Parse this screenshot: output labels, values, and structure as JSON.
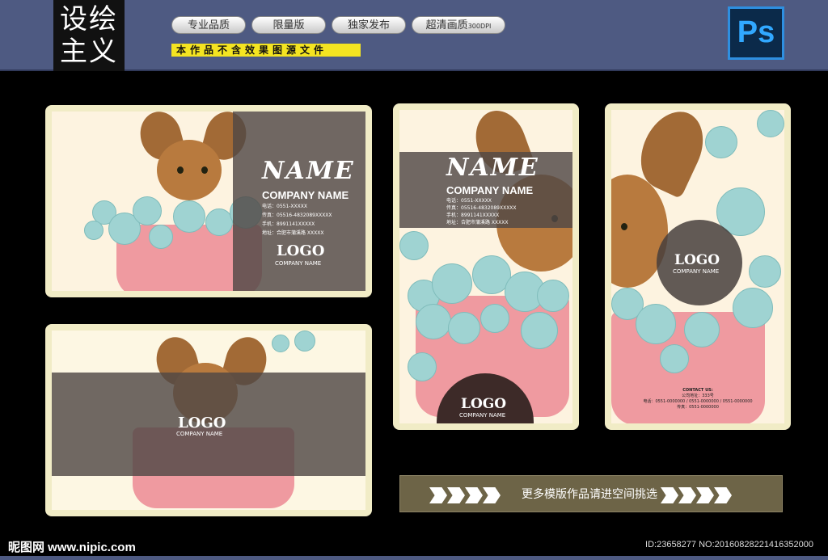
{
  "header": {
    "logo_text": "设绘\n主义",
    "pills": [
      {
        "label": "专业品质"
      },
      {
        "label": "限量版"
      },
      {
        "label": "独家发布"
      },
      {
        "label": "超清画质",
        "small": "300DPI"
      }
    ],
    "notice": "本作品不含效果图源文件",
    "app_icon": {
      "name": "photoshop-icon",
      "label": "Ps",
      "color": "#31a8ff"
    }
  },
  "cards": {
    "front": {
      "name": "NAME",
      "company": "COMPANY NAME",
      "phone": "电话：0551-XXXXX",
      "fax": "传真：05516-4832089XXXXX",
      "mobile": "手机：8991141XXXXX",
      "address": "地址：合肥市蒲溪路 XXXXX",
      "logo": "LOGO",
      "logo_company": "COMPANY NAME"
    },
    "back": {
      "logo": "LOGO",
      "logo_company": "COMPANY NAME"
    },
    "vertical_front": {
      "name": "NAME",
      "company": "COMPANY NAME",
      "phone": "电话：0551-XXXXX",
      "fax": "传真：05516-4832089XXXXX",
      "mobile": "手机：8991141XXXXX",
      "address": "地址：合肥市蒲溪路 XXXXX",
      "logo": "LOGO",
      "logo_company": "COMPANY NAME"
    },
    "vertical_back": {
      "logo": "LOGO",
      "logo_company": "COMPANY NAME",
      "contact_title": "CONTACT US:",
      "contact_address": "公司地址：333号",
      "contact_phones": "电话：0551-0000000 / 0551-0000000 / 0551-0000000",
      "contact_fax": "传真：0551-0000000"
    }
  },
  "banner": {
    "text": "更多模版作品请进空间挑选"
  },
  "watermark": {
    "left": "昵图网 www.nipic.com",
    "right": "ID:23658277 NO:20160828221416352000"
  },
  "colors": {
    "topbar": "#4e5a82",
    "card_frame": "#f1ecc6",
    "tub": "#ef9aa0",
    "bubble": "#9fd3d2",
    "dog": "#b87a3e",
    "overlay": "#504846"
  }
}
